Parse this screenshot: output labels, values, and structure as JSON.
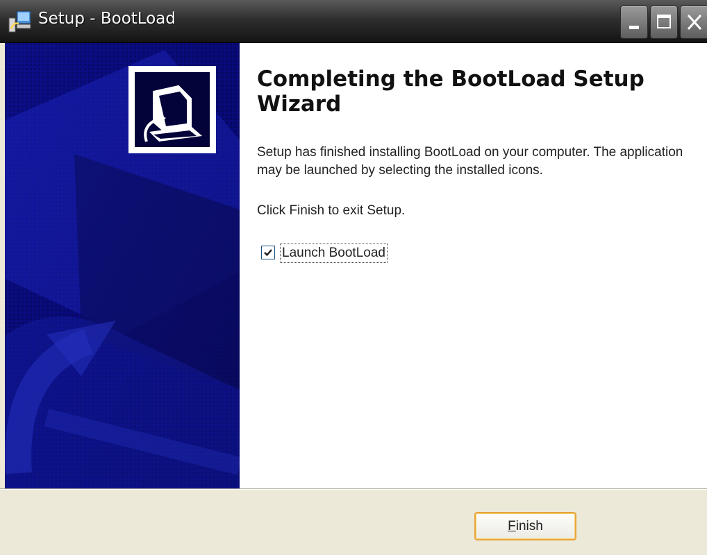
{
  "window": {
    "title": "Setup - BootLoad",
    "controls": {
      "minimize": "minimize",
      "maximize": "maximize",
      "close": "close"
    }
  },
  "icons": {
    "app": "setup-icon",
    "banner": "computer-icon",
    "check": "checkmark-icon"
  },
  "content": {
    "heading": "Completing the BootLoad Setup Wizard",
    "description": "Setup has finished installing BootLoad on your computer. The application may be launched by selecting the installed icons.",
    "instruction": "Click Finish to exit Setup.",
    "launch_checkbox": {
      "label": "Launch BootLoad",
      "checked": true
    }
  },
  "footer": {
    "finish_button": {
      "mnemonic": "F",
      "rest": "inish"
    }
  },
  "colors": {
    "banner": "#07076e",
    "button_focus": "#e7a53a"
  }
}
